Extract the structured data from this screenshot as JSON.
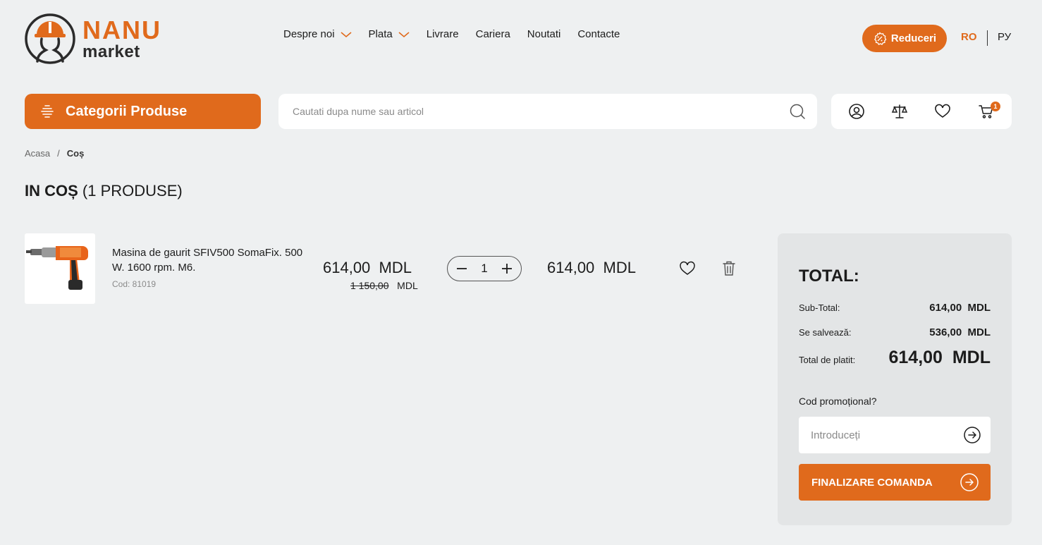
{
  "brand": {
    "name_top": "NANU",
    "name_bottom": "market"
  },
  "nav": {
    "items": [
      {
        "label": "Despre noi",
        "has_dropdown": true
      },
      {
        "label": "Plata",
        "has_dropdown": true
      },
      {
        "label": "Livrare",
        "has_dropdown": false
      },
      {
        "label": "Cariera",
        "has_dropdown": false
      },
      {
        "label": "Noutati",
        "has_dropdown": false
      },
      {
        "label": "Contacte",
        "has_dropdown": false
      }
    ]
  },
  "header": {
    "discount_label": "Reduceri",
    "lang_ro": "RO",
    "lang_ru": "РУ"
  },
  "toolbar": {
    "categories_label": "Categorii Produse",
    "search_placeholder": "Cautati dupa nume sau articol",
    "cart_count": "1",
    "icons": [
      "user-icon",
      "compare-scale-icon",
      "heart-icon",
      "cart-icon"
    ]
  },
  "breadcrumb": {
    "home": "Acasa",
    "separator": "/",
    "current": "Coș"
  },
  "page": {
    "title_strong": "IN COȘ",
    "title_count": "(1 PRODUSE)"
  },
  "cart_item": {
    "name": "Masina de gaurit SFIV500 SomaFix. 500 W. 1600 rpm. M6.",
    "code": "Cod: 81019",
    "price": "614,00",
    "currency": "MDL",
    "old_price": "1 150,00",
    "quantity": "1",
    "line_total": "614,00"
  },
  "summary": {
    "title": "TOTAL:",
    "subtotal_label": "Sub-Total:",
    "subtotal_value": "614,00  MDL",
    "saved_label": "Se salvează:",
    "saved_value": "536,00  MDL",
    "total_label": "Total de platit:",
    "total_value": "614,00  MDL",
    "promo_label": "Cod promoțional?",
    "promo_placeholder": "Introduceți",
    "checkout_label": "FINALIZARE COMANDA"
  },
  "colors": {
    "accent": "#e06a1c",
    "background": "#eef0f1",
    "panel": "#e3e5e6"
  }
}
